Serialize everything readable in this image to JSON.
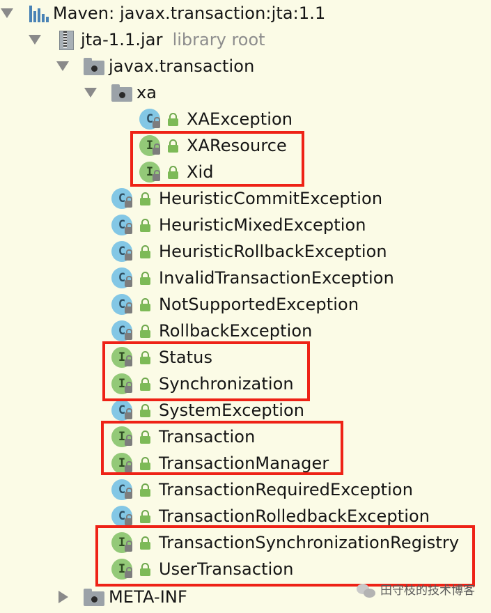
{
  "tree": {
    "root": {
      "label": "Maven: javax.transaction:jta:1.1",
      "icon": "maven-library-icon",
      "expanded": true
    },
    "jar": {
      "label": "jta-1.1.jar",
      "sublabel": "library root",
      "icon": "jar-icon",
      "expanded": true
    },
    "package": {
      "label": "javax.transaction",
      "icon": "package-folder-icon",
      "expanded": true
    },
    "subpackage": {
      "label": "xa",
      "icon": "package-folder-icon",
      "expanded": true
    },
    "xa_items": [
      {
        "label": "XAException",
        "kind": "C"
      },
      {
        "label": "XAResource",
        "kind": "I"
      },
      {
        "label": "Xid",
        "kind": "I"
      }
    ],
    "items": [
      {
        "label": "HeuristicCommitException",
        "kind": "C"
      },
      {
        "label": "HeuristicMixedException",
        "kind": "C"
      },
      {
        "label": "HeuristicRollbackException",
        "kind": "C"
      },
      {
        "label": "InvalidTransactionException",
        "kind": "C"
      },
      {
        "label": "NotSupportedException",
        "kind": "C"
      },
      {
        "label": "RollbackException",
        "kind": "C"
      },
      {
        "label": "Status",
        "kind": "I"
      },
      {
        "label": "Synchronization",
        "kind": "I"
      },
      {
        "label": "SystemException",
        "kind": "C"
      },
      {
        "label": "Transaction",
        "kind": "I"
      },
      {
        "label": "TransactionManager",
        "kind": "I"
      },
      {
        "label": "TransactionRequiredException",
        "kind": "C"
      },
      {
        "label": "TransactionRolledbackException",
        "kind": "C"
      },
      {
        "label": "TransactionSynchronizationRegistry",
        "kind": "I"
      },
      {
        "label": "UserTransaction",
        "kind": "I"
      }
    ],
    "meta_inf": {
      "label": "META-INF",
      "icon": "package-folder-icon",
      "expanded": false
    }
  },
  "watermark": {
    "text": "田守枝的技术博客",
    "icon": "wechat-icon"
  },
  "colors": {
    "background": "#fbfbe6",
    "class_icon": "#83c7e5",
    "interface_icon": "#93c978",
    "highlight_box": "#ee2216"
  }
}
